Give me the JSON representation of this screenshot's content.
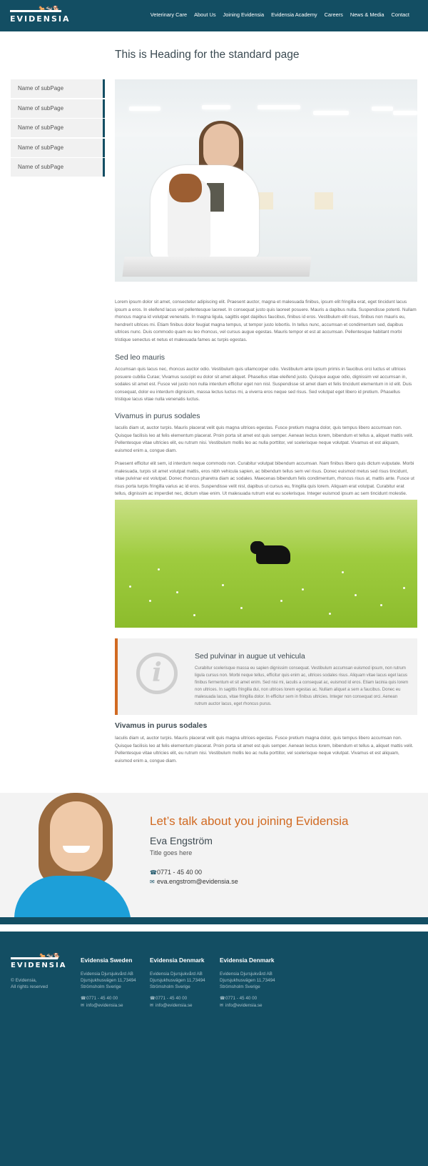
{
  "header": {
    "logo_text": "EVIDENSIA",
    "nav": [
      "Veterinary Care",
      "About Us",
      "Joining Evidensia",
      "Evidensia Academy",
      "Careers",
      "News & Media",
      "Contact"
    ]
  },
  "sidebar": {
    "items": [
      {
        "label": "Name of subPage"
      },
      {
        "label": "Name of subPage"
      },
      {
        "label": "Name of subPage"
      },
      {
        "label": "Name of subPage"
      },
      {
        "label": "Name of subPage"
      }
    ]
  },
  "main": {
    "title": "This is Heading for the standard page",
    "paragraph1": "Lorem ipsum dolor sit amet, consectetur adipiscing elit. Praesent auctor, magna et malesuada finibus, ipsum elit fringilla erat, eget tincidunt lacus ipsum a eros. In eleifend lacus vel pellentesque laoreet. In consequat justo quis laoreet posuere. Mauris a dapibus nulla. Suspendisse potenti. Nullam rhoncus magna id volutpat venenatis. In magna ligula, sagittis eget dapibus faucibus, finibus id eros. Vestibulum elit risus, finibus non mauris eu, hendrerit ultrices mi. Etiam finibus dolor feugiat magna tempus, ut tempor justo lobortis. In tellus nunc, accumsan et condimentum sed, dapibus ultrices nunc. Duis commodo quam eu leo rhoncus, vel cursus augue egestas. Mauris tempor et est at accumsan. Pellentesque habitant morbi tristique senectus et netus et malesuada fames ac turpis egestas.",
    "heading2": "Sed leo mauris",
    "paragraph2": "Accumsan quis lacus nec, rhoncus auctor odio. Vestibulum quis ullamcorper odio. Vestibulum ante ipsum primis in faucibus orci luctus et ultrices posuere cubilia Curae; Vivamus suscipit eu dolor sit amet aliquet. Phasellus vitae eleifend justo. Quisque augue odio, dignissim vel accumsan in, sodales sit amet est. Fusce vel justo non nulla interdum efficitur eget non nisl. Suspendisse sit amet diam et felis tincidunt elementum in id elit. Duis consequat, dolor eu interdum dignissim, massa lectus luctus mi, a viverra eros neque sed risus. Sed volutpat eget libero id pretium. Phasellus tristique lacus vitae nulla venenatis luctus.",
    "heading3": "Vivamus in purus sodales",
    "paragraph3": "Iaculis diam ut, auctor turpis. Mauris placerat velit quis magna ultrices egestas. Fusce pretium magna dolor, quis tempus libero accumsan non. Quisque facilisis leo at felis elementum placerat. Proin porta sit amet est quis semper. Aenean lectus lorem, bibendum et tellus a, aliquet mattis velit. Pellentesque vitae ultricies elit, eu rutrum nisi. Vestibulum mollis leo ac nulla porttitor, vel scelerisque neque volutpat. Vivamus et est aliquam, euismod enim a, congue diam.",
    "paragraph4": "Praesent efficitur elit sem, id interdum neque commodo non. Curabitur volutpat bibendum accumsan. Nam finibus libero quis dictum vulputate. Morbi malesuada, turpis sit amet volutpat mattis, eros nibh vehicula sapien, ac bibendum tellus sem vel risus. Donec euismod metus sed risus tincidunt, vitae pulvinar est volutpat. Donec rhoncus pharetra diam ac sodales. Maecenas bibendum felis condimentum, rhoncus risus at, mattis ante. Fusce ut risus porta turpis fringilla varius ac id eros. Suspendisse velit nisl, dapibus ut cursus eu, fringilla quis lorem. Aliquam erat volutpat. Curabitur erat tellus, dignissim ac imperdiet nec, dictum vitae enim. Ut malesuada rutrum erat eu scelerisque. Integer euismod ipsum ac sem tincidunt molestie.",
    "info_box": {
      "title": "Sed pulvinar in augue ut vehicula",
      "text": "Curabitur scelerisque massa eu sapien dignissim consequat. Vestibulum accumsan euismod ipsum, non rutrum ligula cursus non. Morbi neque tellus, efficitur quis enim ac, ultrices sodales risus. Aliquam vitae lacus eget lacus finibus fermentum et sit amet enim. Sed nisi mi, iaculis a consequat ac, euismod id eros. Etiam lacinia quis lorem non ultrices. In sagittis fringilla dui, non ultrices lorem egestas ac. Nullam aliquet a sem a faucibus. Donec eu malesuada lacus, vitae fringilla dolor. In efficitur sem in finibus ultricies. Integer non consequat orci. Aenean rutrum auctor lacus, eget rhoncus purus."
    },
    "heading4": "Vivamus in purus sodales",
    "paragraph5": "Iaculis diam ut, auctor turpis. Mauris placerat velit quis magna ultrices egestas. Fusce pretium magna dolor, quis tempus libero accumsan non. Quisque facilisis leo at felis elementum placerat. Proin porta sit amet est quis semper. Aenean lectus lorem, bibendum et tellus a, aliquet mattis velit. Pellentesque vitae ultricies elit, eu rutrum nisi. Vestibulum mollis leo ac nulla porttitor, vel scelerisque neque volutpat. Vivamus et est aliquam, euismod enim a, congue diam."
  },
  "contact": {
    "heading": "Let’s talk about you joining Evidensia",
    "name": "Eva Engström",
    "title": "Title goes here",
    "phone": "0771 - 45 40 00",
    "email": "eva.engstrom@evidensia.se"
  },
  "footer": {
    "logo_text": "EVIDENSIA",
    "copyright_line1": "© Evidensia,",
    "copyright_line2": "All rights reserved",
    "columns": [
      {
        "title": "Evidensia Sweden",
        "line1": "Evidensia Djursjukvård AB",
        "line2": "Djursjukhusvägen 11,73494",
        "line3": "Strömsholm Sverige",
        "phone": "0771 - 45 40 00",
        "email": "info@evidensia.se"
      },
      {
        "title": "Evidensia Denmark",
        "line1": "Evidensia Djursjukvård AB",
        "line2": "Djursjukhusvägen 11,73494",
        "line3": "Strömsholm Sverige",
        "phone": "0771 - 45 40 00",
        "email": "info@evidensia.se"
      },
      {
        "title": "Evidensia Denmark",
        "line1": "Evidensia Djursjukvård AB",
        "line2": "Djursjukhusvägen 11,73494",
        "line3": "Strömsholm Sverige",
        "phone": "0771 - 45 40 00",
        "email": "info@evidensia.se"
      }
    ]
  },
  "colors": {
    "brand": "#134e63",
    "accent": "#d16a22"
  }
}
